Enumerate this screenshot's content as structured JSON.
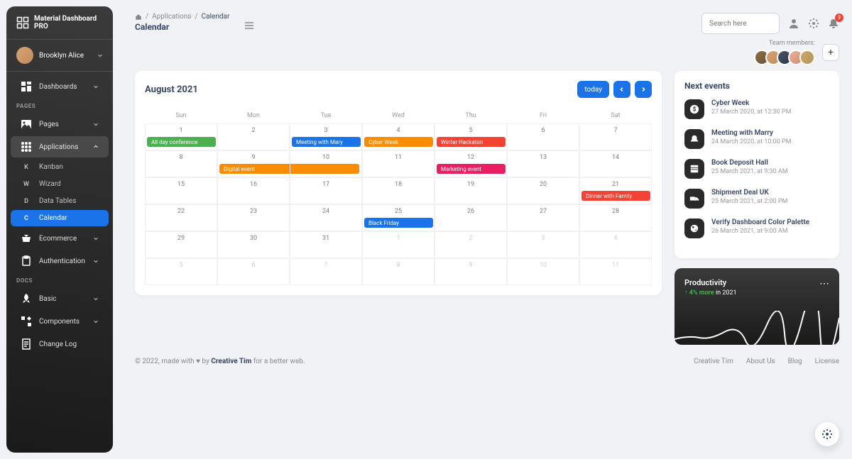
{
  "brand": "Material Dashboard PRO",
  "user": {
    "name": "Brooklyn Alice"
  },
  "sections": {
    "pages_label": "PAGES",
    "docs_label": "DOCS"
  },
  "nav": {
    "dashboards": "Dashboards",
    "pages": "Pages",
    "applications": "Applications",
    "ecommerce": "Ecommerce",
    "authentication": "Authentication",
    "basic": "Basic",
    "components": "Components",
    "changelog": "Change Log"
  },
  "subnav": {
    "kanban": {
      "letter": "K",
      "label": "Kanban"
    },
    "wizard": {
      "letter": "W",
      "label": "Wizard"
    },
    "datatables": {
      "letter": "D",
      "label": "Data Tables"
    },
    "calendar": {
      "letter": "C",
      "label": "Calendar"
    }
  },
  "breadcrumb": {
    "applications": "Applications",
    "current": "Calendar"
  },
  "page_title": "Calendar",
  "search_placeholder": "Search here",
  "notification_count": "9",
  "team_label": "Team members:",
  "calendar": {
    "title": "August 2021",
    "today": "today",
    "dow": [
      "Sun",
      "Mon",
      "Tue",
      "Wed",
      "Thu",
      "Fri",
      "Sat"
    ],
    "weeks": [
      [
        "1",
        "2",
        "3",
        "4",
        "5",
        "6",
        "7"
      ],
      [
        "8",
        "9",
        "10",
        "11",
        "12",
        "13",
        "14"
      ],
      [
        "15",
        "16",
        "17",
        "18",
        "19",
        "20",
        "21"
      ],
      [
        "22",
        "23",
        "24",
        "25",
        "26",
        "27",
        "28"
      ],
      [
        "29",
        "30",
        "31",
        "1",
        "2",
        "3",
        "4"
      ],
      [
        "5",
        "6",
        "7",
        "8",
        "9",
        "10",
        "11"
      ]
    ],
    "events": {
      "all_day": "All day conference",
      "meeting_mary": "Meeting with Mary",
      "cyber_week": "Cyber Week",
      "winter_hack": "Winter Hackaton",
      "digital_event": "Digital event",
      "marketing_event": "Marketing event",
      "dinner_family": "Dinner with Family",
      "black_friday": "Black Friday"
    }
  },
  "next_events": {
    "title": "Next events",
    "items": [
      {
        "name": "Cyber Week",
        "date": "27 March 2020, at 12:30 PM"
      },
      {
        "name": "Meeting with Marry",
        "date": "24 March 2020, at 10:00 PM"
      },
      {
        "name": "Book Deposit Hall",
        "date": "25 March 2021, at 9:30 AM"
      },
      {
        "name": "Shipment Deal UK",
        "date": "25 March 2021, at 2:00 PM"
      },
      {
        "name": "Verify Dashboard Color Palette",
        "date": "26 March 2021, at 9:00 AM"
      }
    ]
  },
  "productivity": {
    "title": "Productivity",
    "percent": "4% more",
    "year": "in 2021"
  },
  "footer": {
    "copyright_prefix": "© 2022, made with ",
    "copyright_mid": " by ",
    "author": "Creative Tim",
    "suffix": " for a better web.",
    "links": [
      "Creative Tim",
      "About Us",
      "Blog",
      "License"
    ]
  }
}
